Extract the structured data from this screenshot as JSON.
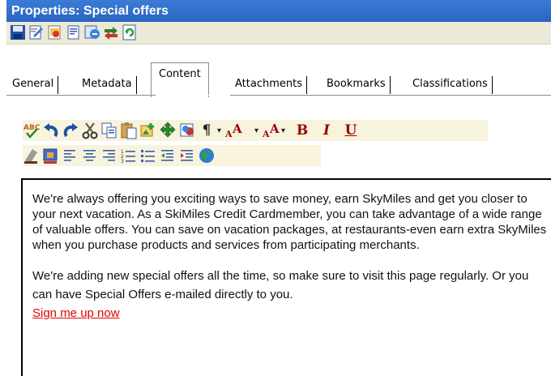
{
  "window": {
    "title": "Properties: Special offers"
  },
  "toolbar": {
    "icons": [
      "save-icon",
      "edit-properties-icon",
      "preview-icon",
      "report-icon",
      "publish-icon",
      "compare-icon",
      "refresh-icon"
    ]
  },
  "tabs": [
    {
      "label": "General",
      "active": false
    },
    {
      "label": "Metadata",
      "active": false
    },
    {
      "label": "Content",
      "active": true
    },
    {
      "label": "Attachments",
      "active": false
    },
    {
      "label": "Bookmarks",
      "active": false
    },
    {
      "label": "Classifications",
      "active": false
    }
  ],
  "editor": {
    "bold_label": "B",
    "italic_label": "I",
    "underline_label": "U",
    "paragraph_1": "We're always offering you exciting ways to save money, earn SkyMiles and get you closer to your next vacation. As a SkiMiles Credit Cardmember, you can take advantage of a wide range of valuable offers.  You can save on vacation packages, at restaurants-even earn extra SkyMiles when you purchase products and services from participating merchants.",
    "paragraph_2": "We're adding new special offers all the time, so make sure to visit this page regularly. Or you can have Special Offers e-mailed directly to you.",
    "link_text": "Sign me up now"
  },
  "colors": {
    "titlebar": "#2a63bf",
    "link": "#e00000",
    "toolbar_bg": "#f8f3dd"
  }
}
